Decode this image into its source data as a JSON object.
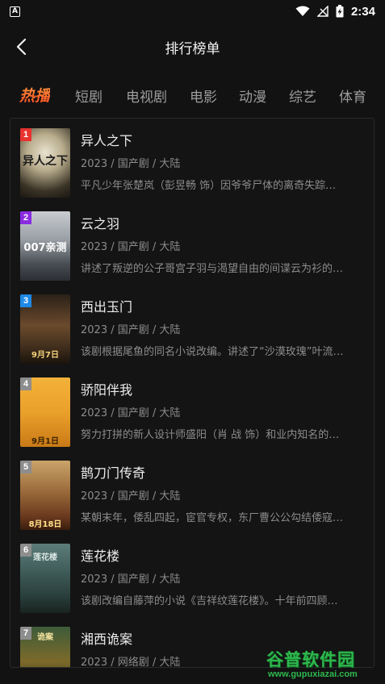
{
  "status_bar": {
    "app_icon_letter": "A",
    "time": "2:34",
    "icons": [
      "wifi-icon",
      "no-signal-icon",
      "battery-charging-icon"
    ]
  },
  "header": {
    "title": "排行榜单"
  },
  "tabs": [
    {
      "label": "热播",
      "active": true
    },
    {
      "label": "短剧",
      "active": false
    },
    {
      "label": "电视剧",
      "active": false
    },
    {
      "label": "电影",
      "active": false
    },
    {
      "label": "动漫",
      "active": false
    },
    {
      "label": "综艺",
      "active": false
    },
    {
      "label": "体育",
      "active": false
    }
  ],
  "items": [
    {
      "rank": "1",
      "title": "异人之下",
      "meta": "2023 / 国产剧 / 大陆",
      "desc": "平凡少年张楚岚（彭昱畅 饰）因爷爷尸体的离奇失踪…",
      "poster_text": "异人之下",
      "badge_color": "#e8332f"
    },
    {
      "rank": "2",
      "title": "云之羽",
      "meta": "2023 / 国产剧 / 大陆",
      "desc": "讲述了叛逆的公子哥宫子羽与渴望自由的间谍云为衫的…",
      "poster_text": "007亲测",
      "badge_color": "#8a2be2"
    },
    {
      "rank": "3",
      "title": "西出玉门",
      "meta": "2023 / 国产剧 / 大陆",
      "desc": "该剧根据尾鱼的同名小说改编。讲述了“沙漠玫瑰”叶流…",
      "poster_text": "9月7日",
      "badge_color": "#1e88e5"
    },
    {
      "rank": "4",
      "title": "骄阳伴我",
      "meta": "2023 / 国产剧 / 大陆",
      "desc": "努力打拼的新人设计师盛阳（肖 战 饰）和业内知名的…",
      "poster_text": "9月1日",
      "badge_color": "#8d8d8d"
    },
    {
      "rank": "5",
      "title": "鹊刀门传奇",
      "meta": "2023 / 国产剧 / 大陆",
      "desc": "某朝末年，倭乱四起，宦官专权，东厂曹公公勾结倭寇…",
      "poster_text": "8月18日",
      "badge_color": "#8d8d8d"
    },
    {
      "rank": "6",
      "title": "莲花楼",
      "meta": "2023 / 国产剧 / 大陆",
      "desc": "该剧改编自藤萍的小说《吉祥纹莲花楼》。十年前四顾…",
      "poster_text": "莲花楼",
      "badge_color": "#8d8d8d"
    },
    {
      "rank": "7",
      "title": "湘西诡案",
      "meta": "2023 / 网络剧 / 大陆",
      "desc": "",
      "poster_text": "诡案",
      "badge_color": "#8d8d8d"
    }
  ],
  "watermark": {
    "main": "谷普软件园",
    "url": "www.gupuxiazai.com"
  }
}
